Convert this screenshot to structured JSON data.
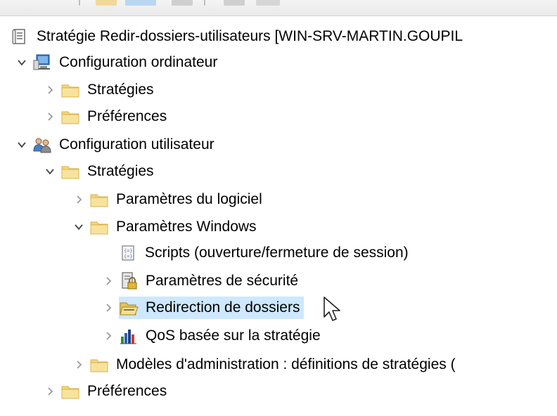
{
  "window": {
    "title": "Stratégie Redir-dossiers-utilisateurs [WIN-SRV-MARTIN.GOUPIL"
  },
  "tree": {
    "root_label": "Stratégie Redir-dossiers-utilisateurs [WIN-SRV-MARTIN.GOUPIL",
    "computer_config": "Configuration ordinateur",
    "computer_policies": "Stratégies",
    "computer_prefs": "Préférences",
    "user_config": "Configuration utilisateur",
    "user_policies": "Stratégies",
    "software_settings": "Paramètres du logiciel",
    "windows_settings": "Paramètres Windows",
    "scripts": "Scripts (ouverture/fermeture de session)",
    "security_settings": "Paramètres de sécurité",
    "folder_redirection": "Redirection de dossiers",
    "qos": "QoS basée sur la stratégie",
    "admin_templates": "Modèles d'administration : définitions de stratégies (",
    "user_prefs": "Préférences"
  },
  "colors": {
    "selection": "#cde8ff",
    "folder": "#f2d16b",
    "text": "#000000"
  },
  "icons": {
    "root": "policy-document-icon",
    "computer": "computer-icon",
    "user": "users-icon",
    "folder": "folder-icon",
    "scripts": "script-icon",
    "security": "security-lock-icon",
    "open_folder": "open-folder-icon",
    "qos": "bar-chart-icon"
  }
}
